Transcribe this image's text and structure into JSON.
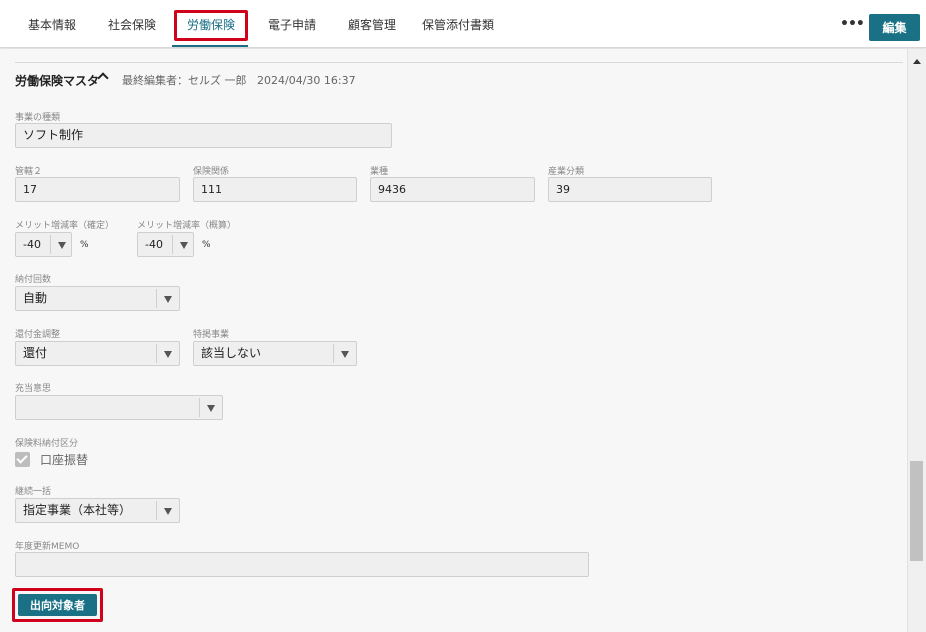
{
  "tabs": [
    {
      "label": "基本情報"
    },
    {
      "label": "社会保険"
    },
    {
      "label": "労働保険"
    },
    {
      "label": "電子申請"
    },
    {
      "label": "顧客管理"
    },
    {
      "label": "保管添付書類"
    }
  ],
  "toolbar": {
    "more_label": "•••",
    "edit_label": "編集"
  },
  "section": {
    "title": "労働保険マスタ",
    "last_editor_label": "最終編集者：セルズ 一郎",
    "last_edited": "2024/04/30 16:37"
  },
  "form": {
    "business_type": {
      "label": "事業の種類",
      "value": "ソフト制作"
    },
    "jurisdiction": {
      "label": "管轄２",
      "value": "17"
    },
    "insurance_relation": {
      "label": "保険関係",
      "value": "111"
    },
    "industry": {
      "label": "業種",
      "value": "9436"
    },
    "industry_class": {
      "label": "産業分類",
      "value": "39"
    },
    "merit_confirmed": {
      "label": "メリット増減率（確定）",
      "value": "-40",
      "unit": "%"
    },
    "merit_estimated": {
      "label": "メリット増減率（概算）",
      "value": "-40",
      "unit": "%"
    },
    "payment_count": {
      "label": "納付回数",
      "value": "自動"
    },
    "refund_adjust": {
      "label": "還付金調整",
      "value": "還付"
    },
    "special_business": {
      "label": "特掲事業",
      "value": "該当しない"
    },
    "allocation_intent": {
      "label": "充当意思",
      "value": ""
    },
    "premium_payment": {
      "label": "保険料納付区分",
      "checkbox_label": "口座振替"
    },
    "continuous_batch": {
      "label": "継続一括",
      "value": "指定事業（本社等）"
    },
    "annual_memo": {
      "label": "年度更新MEMO",
      "value": ""
    }
  },
  "dispatch_button_label": "出向対象者",
  "colors": {
    "accent": "#1a7186",
    "highlight": "#d0021b"
  }
}
